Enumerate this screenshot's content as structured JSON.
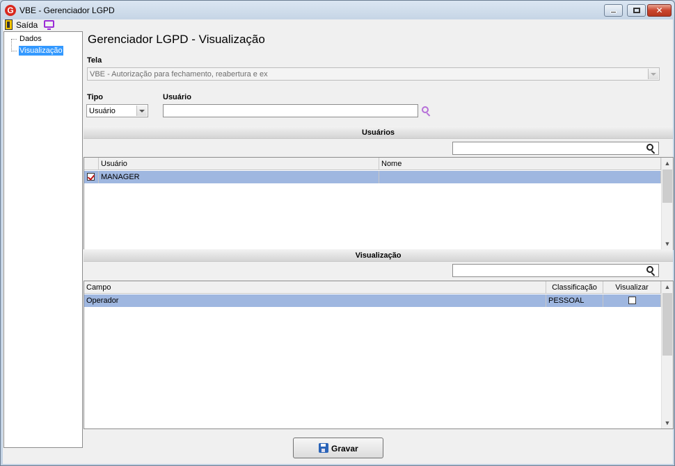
{
  "window": {
    "title": "VBE - Gerenciador LGPD",
    "app_icon_letter": "G"
  },
  "menubar": {
    "exit_label": "Saída"
  },
  "tree": {
    "items": [
      {
        "label": "Dados",
        "selected": false
      },
      {
        "label": "Visualização",
        "selected": true
      }
    ]
  },
  "page": {
    "title": "Gerenciador LGPD - Visualização"
  },
  "form": {
    "tela_label": "Tela",
    "tela_value": "VBE - Autorização para fechamento, reabertura e ex",
    "tipo_label": "Tipo",
    "tipo_value": "Usuário",
    "usuario_label": "Usuário",
    "usuario_value": ""
  },
  "users_section": {
    "title": "Usuários",
    "filter_value": "",
    "columns": [
      "Usuário",
      "Nome"
    ],
    "rows": [
      {
        "checked": true,
        "usuario": "MANAGER",
        "nome": ""
      }
    ]
  },
  "view_section": {
    "title": "Visualização",
    "filter_value": "",
    "columns": [
      "Campo",
      "Classificação",
      "Visualizar"
    ],
    "rows": [
      {
        "campo": "Operador",
        "classificacao": "PESSOAL",
        "visualizar": false
      }
    ]
  },
  "footer": {
    "save_label": "Gravar"
  },
  "colors": {
    "selection_row": "#9fb7e0",
    "tree_selection": "#3399ff",
    "search_accent": "#b56ed8"
  }
}
